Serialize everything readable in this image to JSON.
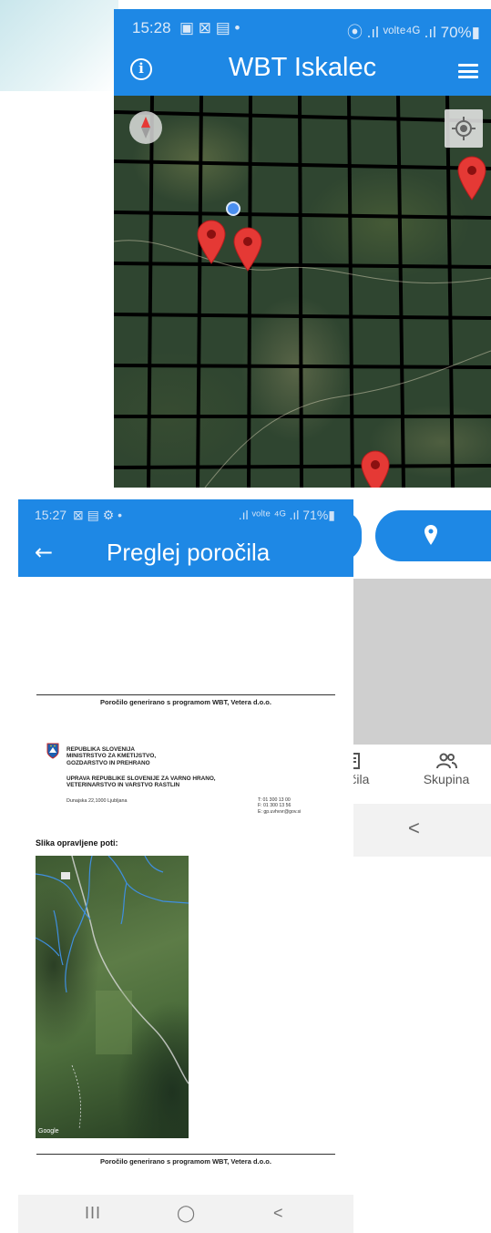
{
  "back_screen": {
    "status_bar": {
      "time": "15:28",
      "left_icons": "▣ ⊠ ▤ •",
      "right": "⦿ .ıl ᵛᵒˡᵗᵉ⁴ᴳ .ıl 70%▮"
    },
    "app_bar": {
      "title": "WBT Iskalec",
      "info_icon": "info-icon",
      "menu_icon": "menu-icon"
    },
    "map": {
      "compass_icon": "compass-icon",
      "locate_icon": "my-location-icon",
      "markers": 4,
      "accent": "#e53935"
    },
    "fab": {
      "icon": "location-pin-icon"
    },
    "bottom_nav": [
      {
        "label": "očila",
        "icon": "report-icon"
      },
      {
        "label": "Skupina",
        "icon": "group-icon"
      }
    ],
    "system_nav": {
      "back": "<"
    }
  },
  "front_screen": {
    "status_bar": {
      "time": "15:27",
      "left_icons": "⊠ ▤ ⚙ •",
      "right": ".ıl ᵛᵒˡᵗᵉ ⁴ᴳ .ıl 71%▮"
    },
    "app_bar": {
      "title": "Preglej poročila",
      "back_icon": "←"
    },
    "report": {
      "header_footer": "Poročilo generirano s programom WBT, Vetera d.o.o.",
      "org_lines": [
        "REPUBLIKA SLOVENIJA",
        "MINISTRSTVO ZA KMETIJSTVO,",
        "GOZDARSTVO IN PREHRANO"
      ],
      "agency_lines": [
        "UPRAVA REPUBLIKE SLOVENIJE ZA VARNO HRANO,",
        "VETERINARSTVO IN VARSTVO RASTLIN"
      ],
      "address": "Dunajska 22,1000 Ljubljana",
      "contacts": [
        "T: 01 300 13 00",
        "F: 01 300 13 56",
        "E: gp.uvhvvr@gov.si"
      ],
      "image_heading": "Slika opravljene poti:",
      "map_attribution": "Google"
    },
    "system_nav": {
      "recents": "III",
      "home": "◯",
      "back": "<"
    }
  },
  "colors": {
    "primary": "#1e88e5",
    "marker": "#e53935",
    "route": "#2f8fe0"
  }
}
